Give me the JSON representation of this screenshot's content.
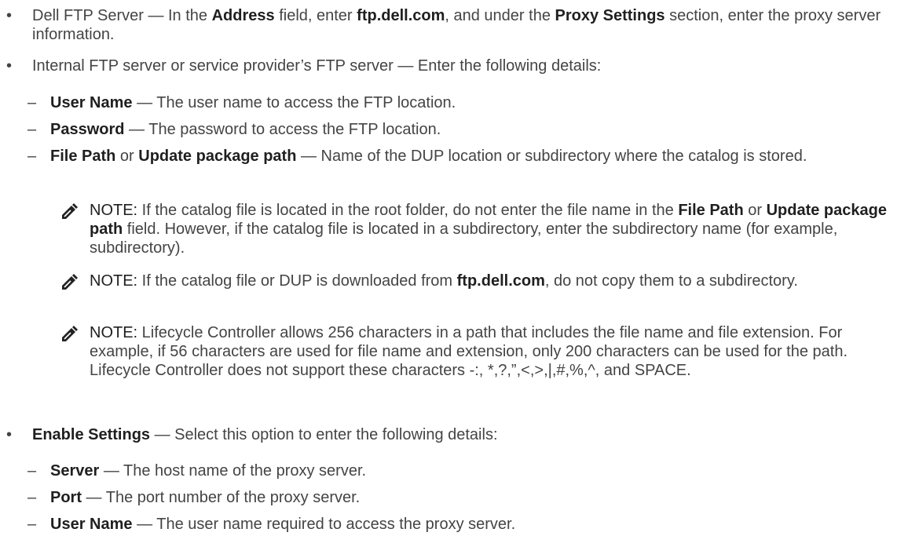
{
  "items": [
    {
      "t1": "Dell FTP Server",
      "t2": " — In the ",
      "t3": "Address",
      "t4": " field, enter ",
      "t5": "ftp.dell.com",
      "t6": ", and under the ",
      "t7": "Proxy Settings",
      "t8": " section, enter the proxy server information."
    },
    {
      "t1": "Internal FTP server or service provider’s FTP server — Enter the following details:"
    }
  ],
  "ftp_details": [
    {
      "term": "User Name",
      "desc": " — The user name to access the FTP location."
    },
    {
      "term": "Password",
      "desc": " — The password to access the FTP location."
    },
    {
      "term": "File Path",
      "mid": " or ",
      "term2": "Update package path",
      "desc": " — Name of the DUP location or subdirectory where the catalog is stored."
    }
  ],
  "notes": [
    {
      "label": "NOTE:",
      "a": " If the catalog file is located in the root folder, do not enter the file name in the ",
      "b": "File Path",
      "c": " or ",
      "d": "Update package path",
      "e": " field. However, if the catalog file is located in a subdirectory, enter the subdirectory name (for example, subdirectory)."
    },
    {
      "label": "NOTE:",
      "a": " If the catalog file or DUP is downloaded from ",
      "b": "ftp.dell.com",
      "c": ", do not copy them to a subdirectory."
    },
    {
      "label": "NOTE:",
      "a": " Lifecycle Controller allows 256 characters in a path that includes the file name and file extension. For example, if 56 characters are used for file name and extension, only 200 characters can be used for the path. Lifecycle Controller does not support these characters -:, *,?,”,<,>,|,#,%,^, and SPACE."
    }
  ],
  "enable": {
    "term": "Enable Settings",
    "desc": " — Select this option to enter the following details:"
  },
  "proxy_details": [
    {
      "term": "Server",
      "desc": " — The host name of the proxy server."
    },
    {
      "term": "Port",
      "desc": " — The port number of the proxy server."
    },
    {
      "term": "User Name",
      "desc": " — The user name required to access the proxy server."
    }
  ],
  "icons": {
    "bullet": "•",
    "dash": "–",
    "note": "pencil-note-icon"
  }
}
